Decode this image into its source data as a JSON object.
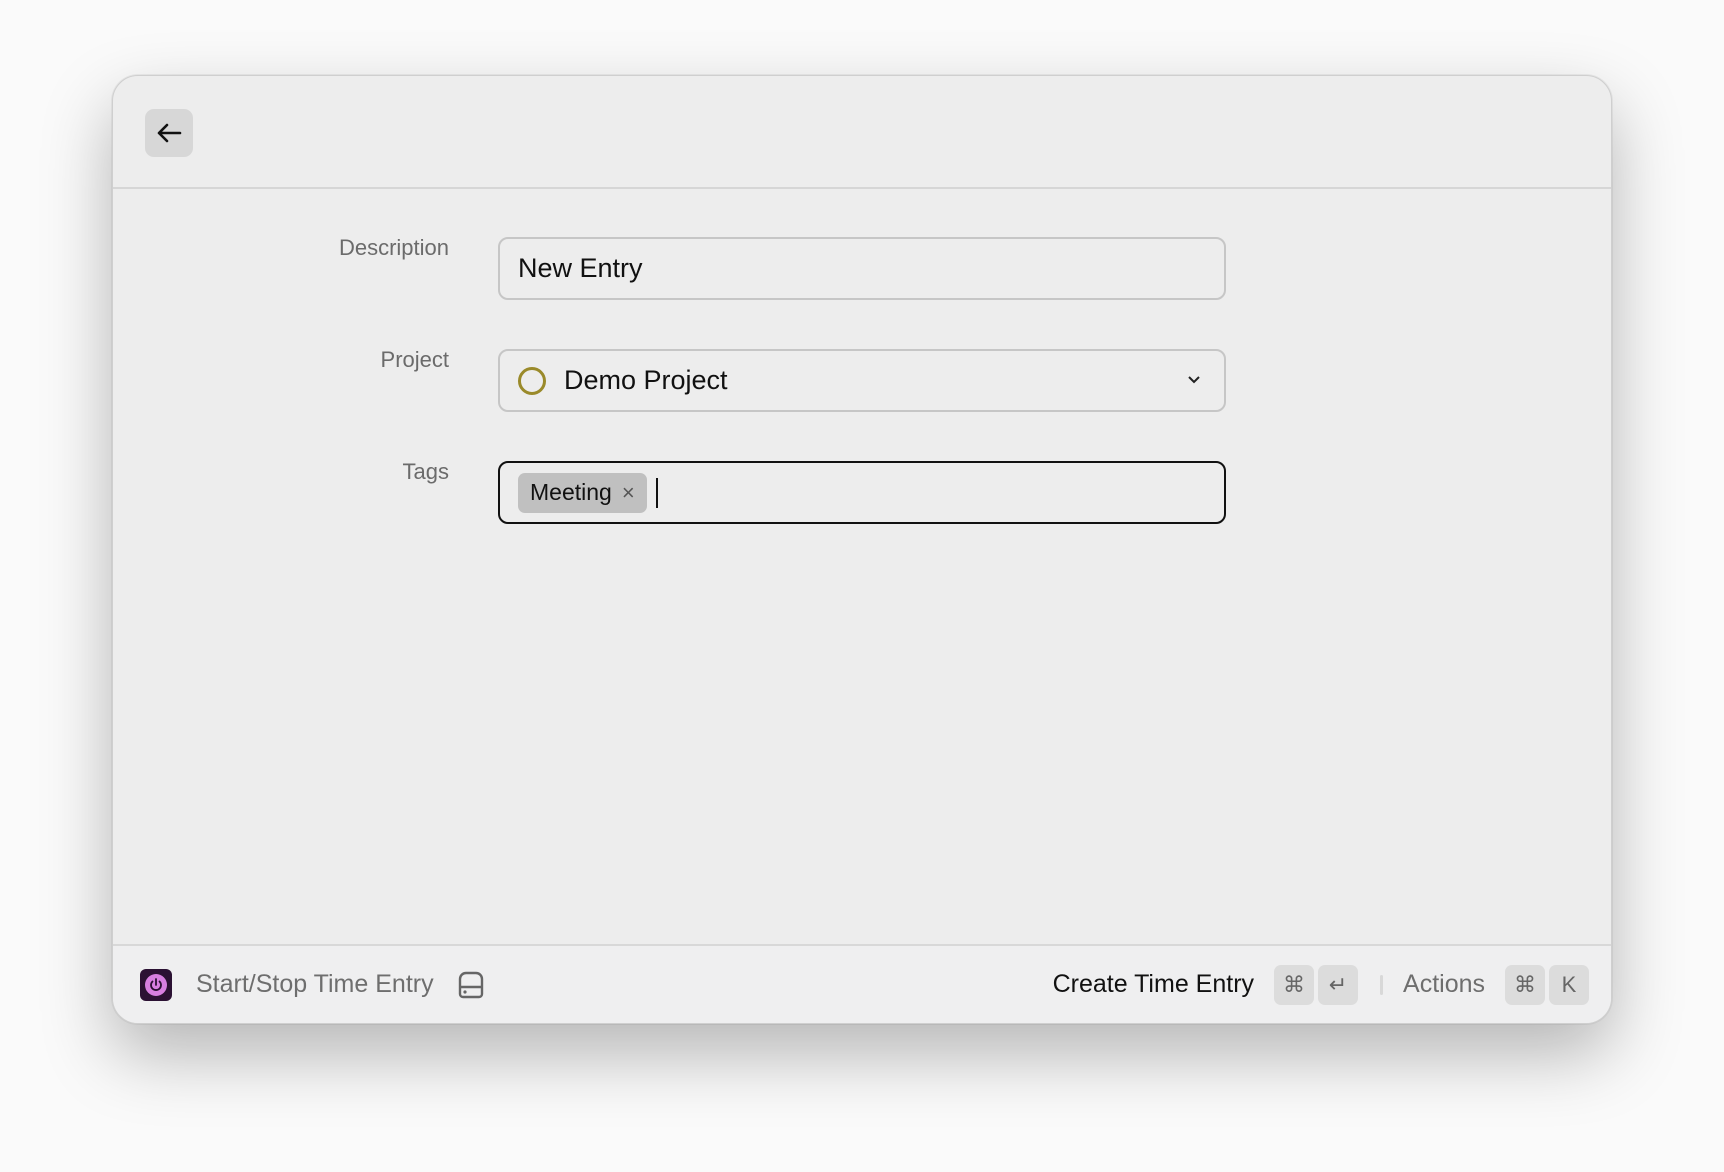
{
  "header": {
    "back_icon": "arrow-left-icon"
  },
  "form": {
    "description": {
      "label": "Description",
      "value": "New Entry"
    },
    "project": {
      "label": "Project",
      "value": "Demo Project",
      "color": "#9a8a2a"
    },
    "tags": {
      "label": "Tags",
      "items": [
        "Meeting"
      ],
      "remove_symbol": "×"
    }
  },
  "footer": {
    "app_icon": "power-icon",
    "app_icon_color": "#d77fe0",
    "command": "Start/Stop Time Entry",
    "primary_action": "Create Time Entry",
    "primary_keys": [
      "⌘",
      "↵"
    ],
    "actions_label": "Actions",
    "actions_keys": [
      "⌘",
      "K"
    ]
  }
}
